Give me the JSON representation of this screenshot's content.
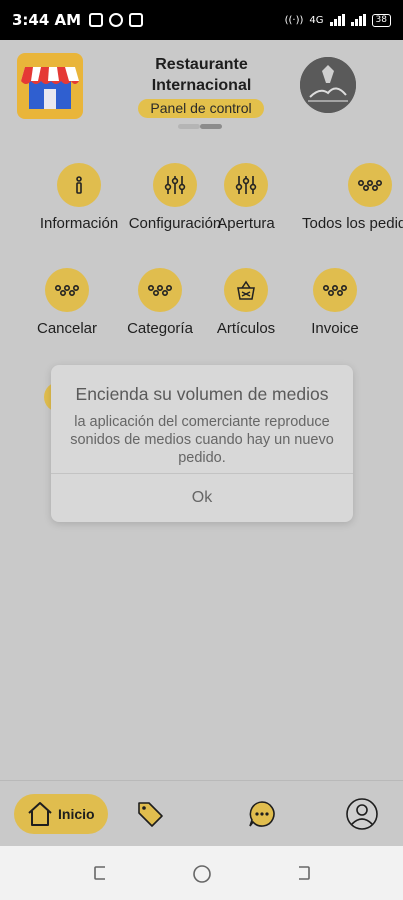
{
  "status_bar": {
    "time": "3:44 AM",
    "network": "4G",
    "battery": "38"
  },
  "header": {
    "title": "Restaurante Internacional",
    "subtitle": "Panel de control",
    "logo_icon": "store-icon",
    "avatar_icon": "profile-photo"
  },
  "menu": {
    "row1": [
      {
        "label": "Información",
        "icon": "info-icon"
      },
      {
        "label": "Configuración",
        "icon": "sliders-icon"
      },
      {
        "label": "Apertura",
        "icon": "sliders-icon"
      },
      {
        "label": "Todos los pedidos",
        "icon": "nodes-icon"
      }
    ],
    "row2": [
      {
        "label": "Cancelar",
        "icon": "nodes-icon"
      },
      {
        "label": "Categoría",
        "icon": "nodes-icon"
      },
      {
        "label": "Artículos",
        "icon": "basket-icon"
      },
      {
        "label": "Invoice",
        "icon": "nodes-icon"
      }
    ]
  },
  "dialog": {
    "title": "Encienda su volumen de medios",
    "message": "la aplicación del comerciante reproduce sonidos de medios cuando hay un nuevo pedido.",
    "ok": "Ok"
  },
  "bottom_nav": {
    "home_label": "Inicio",
    "items": [
      "home-icon",
      "tag-icon",
      "chat-icon",
      "profile-icon"
    ]
  },
  "colors": {
    "accent": "#e0bd4e",
    "background": "#c9c9c9",
    "logo_bg": "#e9b53a"
  }
}
